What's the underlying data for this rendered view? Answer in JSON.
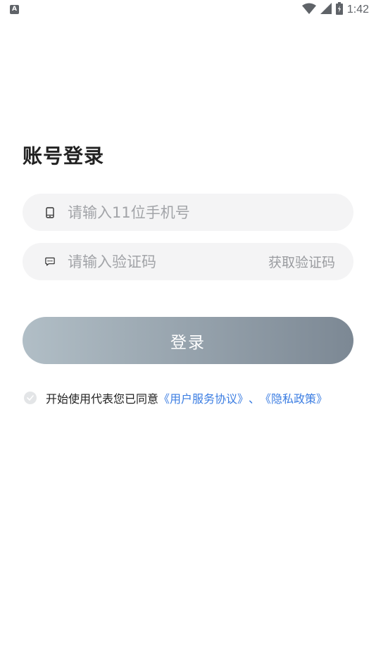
{
  "status_bar": {
    "left_icon_letter": "A",
    "time": "1:42"
  },
  "login": {
    "title": "账号登录",
    "phone_placeholder": "请输入11位手机号",
    "code_placeholder": "请输入验证码",
    "get_code_label": "获取验证码",
    "submit_label": "登录",
    "button_gradient": [
      "#b1bec6",
      "#7c8894"
    ]
  },
  "agreement": {
    "prefix": "开始使用代表您已同意",
    "user_agreement": "《用户服务协议》",
    "separator": "、",
    "privacy_policy": "《隐私政策》",
    "link_color": "#3b7de2"
  },
  "icons": {
    "phone": "phone-icon",
    "sms": "message-icon",
    "check": "check-icon",
    "wifi": "wifi-icon",
    "signal": "signal-icon",
    "battery": "battery-icon"
  }
}
